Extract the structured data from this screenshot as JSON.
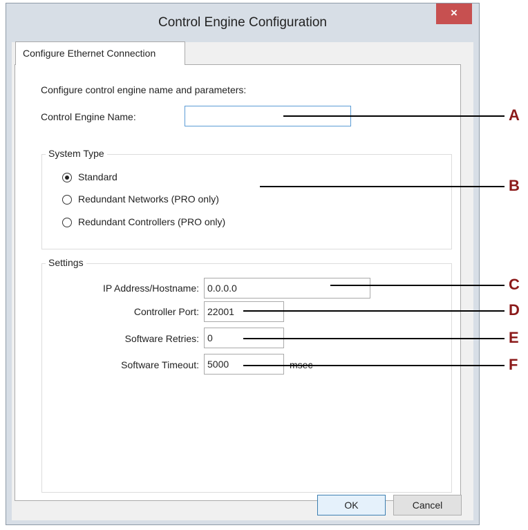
{
  "window": {
    "title": "Control Engine Configuration",
    "close_label": "×"
  },
  "tab": {
    "label": "Configure Ethernet Connection"
  },
  "intro_text": "Configure control engine name and parameters:",
  "engine_name": {
    "label": "Control Engine Name:",
    "value": ""
  },
  "system_type": {
    "title": "System Type",
    "options": [
      {
        "label": "Standard",
        "checked": true
      },
      {
        "label": "Redundant Networks (PRO only)",
        "checked": false
      },
      {
        "label": "Redundant Controllers (PRO only)",
        "checked": false
      }
    ]
  },
  "settings": {
    "title": "Settings",
    "ip": {
      "label": "IP Address/Hostname:",
      "value": "0.0.0.0"
    },
    "port": {
      "label": "Controller Port:",
      "value": "22001"
    },
    "retries": {
      "label": "Software Retries:",
      "value": "0"
    },
    "timeout": {
      "label": "Software Timeout:",
      "value": "5000",
      "unit": "msec"
    }
  },
  "buttons": {
    "ok": "OK",
    "cancel": "Cancel"
  },
  "callouts": [
    "A",
    "B",
    "C",
    "D",
    "E",
    "F"
  ],
  "colors": {
    "close_button": "#c75050",
    "callout_letter": "#8b1a1a",
    "focus_border": "#5b9bd5"
  }
}
